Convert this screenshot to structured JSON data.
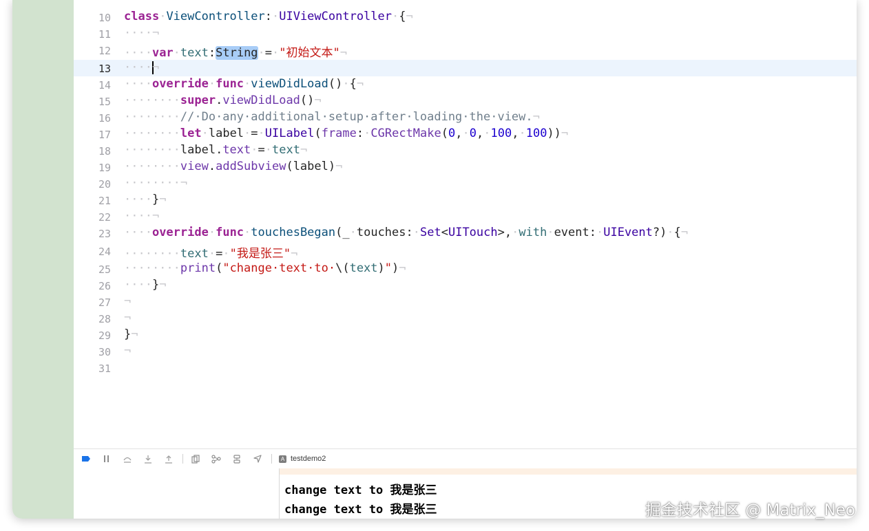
{
  "editor": {
    "current_line": "13",
    "lines": [
      {
        "num": "10",
        "tokens": [
          [
            "kw",
            "class"
          ],
          [
            "ws",
            "·"
          ],
          [
            "cl",
            "ViewController"
          ],
          [
            "",
            ":"
          ],
          [
            "ws",
            "·"
          ],
          [
            "ty",
            "UIViewController"
          ],
          [
            "ws",
            "·"
          ],
          [
            "",
            "{"
          ],
          [
            "ws",
            "¬"
          ]
        ]
      },
      {
        "num": "11",
        "tokens": [
          [
            "ws",
            "····¬"
          ]
        ]
      },
      {
        "num": "12",
        "tokens": [
          [
            "ws",
            "····"
          ],
          [
            "kw",
            "var"
          ],
          [
            "ws",
            "·"
          ],
          [
            "pr",
            "text"
          ],
          [
            "",
            ":"
          ],
          [
            "sel",
            "String"
          ],
          [
            "ws",
            "·"
          ],
          [
            "",
            "="
          ],
          [
            "ws",
            "·"
          ],
          [
            "st",
            "\"初始文本\""
          ],
          [
            "ws",
            "¬"
          ]
        ]
      },
      {
        "num": "13",
        "tokens": [
          [
            "ws",
            "····"
          ],
          [
            "caret",
            ""
          ],
          [
            "ws",
            "¬"
          ]
        ]
      },
      {
        "num": "14",
        "tokens": [
          [
            "ws",
            "····"
          ],
          [
            "kw",
            "override"
          ],
          [
            "ws",
            "·"
          ],
          [
            "kw",
            "func"
          ],
          [
            "ws",
            "·"
          ],
          [
            "cl",
            "viewDidLoad"
          ],
          [
            "",
            "()"
          ],
          [
            "ws",
            "·"
          ],
          [
            "",
            "{"
          ],
          [
            "ws",
            "¬"
          ]
        ]
      },
      {
        "num": "15",
        "tokens": [
          [
            "ws",
            "········"
          ],
          [
            "kw",
            "super"
          ],
          [
            "",
            "."
          ],
          [
            "fn",
            "viewDidLoad"
          ],
          [
            "",
            "()"
          ],
          [
            "ws",
            "¬"
          ]
        ]
      },
      {
        "num": "16",
        "tokens": [
          [
            "ws",
            "········"
          ],
          [
            "cm",
            "//·Do·any·additional·setup·after·loading·the·view."
          ],
          [
            "ws",
            "¬"
          ]
        ]
      },
      {
        "num": "17",
        "tokens": [
          [
            "ws",
            "········"
          ],
          [
            "kw",
            "let"
          ],
          [
            "ws",
            "·"
          ],
          [
            "",
            "label"
          ],
          [
            "ws",
            "·"
          ],
          [
            "",
            "="
          ],
          [
            "ws",
            "·"
          ],
          [
            "ty",
            "UILabel"
          ],
          [
            "",
            "("
          ],
          [
            "fn",
            "frame"
          ],
          [
            "",
            ":"
          ],
          [
            "ws",
            "·"
          ],
          [
            "fn",
            "CGRectMake"
          ],
          [
            "",
            "("
          ],
          [
            "nm",
            "0"
          ],
          [
            "",
            ","
          ],
          [
            "ws",
            "·"
          ],
          [
            "nm",
            "0"
          ],
          [
            "",
            ","
          ],
          [
            "ws",
            "·"
          ],
          [
            "nm",
            "100"
          ],
          [
            "",
            ","
          ],
          [
            "ws",
            "·"
          ],
          [
            "nm",
            "100"
          ],
          [
            "",
            "))"
          ],
          [
            "ws",
            "¬"
          ]
        ]
      },
      {
        "num": "18",
        "tokens": [
          [
            "ws",
            "········"
          ],
          [
            "",
            "label."
          ],
          [
            "fn",
            "text"
          ],
          [
            "ws",
            "·"
          ],
          [
            "",
            "="
          ],
          [
            "ws",
            "·"
          ],
          [
            "pr",
            "text"
          ],
          [
            "ws",
            "¬"
          ]
        ]
      },
      {
        "num": "19",
        "tokens": [
          [
            "ws",
            "········"
          ],
          [
            "fn",
            "view"
          ],
          [
            "",
            "."
          ],
          [
            "fn",
            "addSubview"
          ],
          [
            "",
            "(label)"
          ],
          [
            "ws",
            "¬"
          ]
        ]
      },
      {
        "num": "20",
        "tokens": [
          [
            "ws",
            "········¬"
          ]
        ]
      },
      {
        "num": "21",
        "tokens": [
          [
            "ws",
            "····"
          ],
          [
            "",
            "}"
          ],
          [
            "ws",
            "¬"
          ]
        ]
      },
      {
        "num": "22",
        "tokens": [
          [
            "ws",
            "····¬"
          ]
        ]
      },
      {
        "num": "23",
        "tokens": [
          [
            "ws",
            "····"
          ],
          [
            "kw",
            "override"
          ],
          [
            "ws",
            "·"
          ],
          [
            "kw",
            "func"
          ],
          [
            "ws",
            "·"
          ],
          [
            "cl",
            "touchesBegan"
          ],
          [
            "",
            "(_"
          ],
          [
            "ws",
            "·"
          ],
          [
            "",
            "touches:"
          ],
          [
            "ws",
            "·"
          ],
          [
            "ty",
            "Set"
          ],
          [
            "",
            "<"
          ],
          [
            "ty",
            "UITouch"
          ],
          [
            "",
            ">,"
          ],
          [
            "ws",
            "·"
          ],
          [
            "pr",
            "with"
          ],
          [
            "ws",
            "·"
          ],
          [
            "",
            "event:"
          ],
          [
            "ws",
            "·"
          ],
          [
            "ty",
            "UIEvent"
          ],
          [
            "",
            "?)"
          ],
          [
            "ws",
            "·"
          ],
          [
            "",
            "{"
          ],
          [
            "ws",
            "¬"
          ]
        ]
      },
      {
        "num": "24",
        "tokens": [
          [
            "ws",
            "········"
          ],
          [
            "pr",
            "text"
          ],
          [
            "ws",
            "·"
          ],
          [
            "",
            "="
          ],
          [
            "ws",
            "·"
          ],
          [
            "st",
            "\"我是张三\""
          ],
          [
            "ws",
            "¬"
          ]
        ]
      },
      {
        "num": "25",
        "tokens": [
          [
            "ws",
            "········"
          ],
          [
            "fn",
            "print"
          ],
          [
            "",
            "("
          ],
          [
            "st",
            "\"change·text·to·"
          ],
          [
            "",
            "\\("
          ],
          [
            "pr",
            "text"
          ],
          [
            "",
            ")"
          ],
          [
            "st",
            "\""
          ],
          [
            "",
            ")"
          ],
          [
            "ws",
            "¬"
          ]
        ]
      },
      {
        "num": "26",
        "tokens": [
          [
            "ws",
            "····"
          ],
          [
            "",
            "}"
          ],
          [
            "ws",
            "¬"
          ]
        ]
      },
      {
        "num": "27",
        "tokens": [
          [
            "ws",
            "¬"
          ]
        ]
      },
      {
        "num": "28",
        "tokens": [
          [
            "ws",
            "¬"
          ]
        ]
      },
      {
        "num": "29",
        "tokens": [
          [
            "",
            "}"
          ],
          [
            "ws",
            "¬"
          ]
        ]
      },
      {
        "num": "30",
        "tokens": [
          [
            "ws",
            "¬"
          ]
        ]
      },
      {
        "num": "31",
        "tokens": []
      }
    ]
  },
  "debug_bar": {
    "icons": [
      "breakpoint-toggle-icon",
      "pause-icon",
      "step-over-icon",
      "step-into-icon",
      "step-out-icon",
      "debug-view-hierarchy-icon",
      "memory-graph-icon",
      "environment-overrides-icon",
      "simulate-location-icon"
    ],
    "scheme_label": "testdemo2"
  },
  "console": {
    "lines": [
      "change text to 我是张三",
      "change text to 我是张三"
    ]
  },
  "watermark": "掘金技术社区 @ Matrix_Neo"
}
